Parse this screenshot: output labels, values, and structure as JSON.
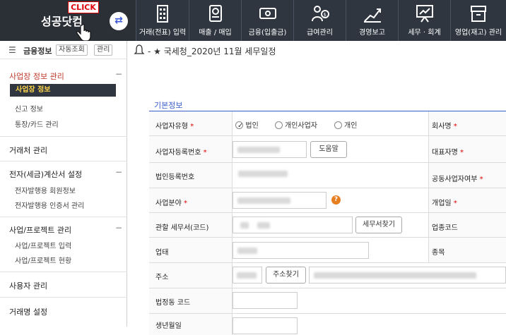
{
  "brand": {
    "name": "성공닷컴",
    "click_badge": "CLICK"
  },
  "top_menu": [
    {
      "label": "거래(전표) 입력",
      "icon": "building-icon"
    },
    {
      "label": "매출 / 매입",
      "icon": "report-icon"
    },
    {
      "label": "금융(입출금)",
      "icon": "money-icon"
    },
    {
      "label": "급여관리",
      "icon": "person-coin-icon"
    },
    {
      "label": "경영보고",
      "icon": "growth-chart-icon"
    },
    {
      "label": "세무 · 회계",
      "icon": "presentation-icon"
    },
    {
      "label": "영업(재고) 관리",
      "icon": "box-icon"
    }
  ],
  "sidebar": {
    "title": "금융정보",
    "auto_btn": "자동조회",
    "manage_btn": "관리",
    "sections": [
      {
        "title": "사업장 정보 관리",
        "items": [
          "사업장 정보",
          "신고 정보",
          "통장/카드 관리"
        ]
      },
      {
        "title": "거래처 관리",
        "items": []
      },
      {
        "title": "전자(세금)계산서 설정",
        "items": [
          "전자발행용 회원정보",
          "전자발행용 인증서 관리"
        ]
      },
      {
        "title": "사업/프로젝트 관리",
        "items": [
          "사업/프로젝트 입력",
          "사업/프로젝트 현황"
        ]
      },
      {
        "title": "사용자 관리",
        "items": []
      },
      {
        "title": "거래명 설정",
        "items": []
      }
    ]
  },
  "breadcrumb": "- ★ 국세청_2020년 11월 세무일정",
  "form": {
    "section_title": "기본정보",
    "business_type_label": "사업자유형",
    "business_type_options": [
      "법인",
      "개인사업자",
      "개인"
    ],
    "business_type_selected": "법인",
    "reg_no_label": "사업자등록번호",
    "help_btn": "도움말",
    "corp_no_label": "법인등록번호",
    "field_label": "사업분야",
    "tax_office_label": "관할 세무서(코드)",
    "tax_office_btn": "세무서찾기",
    "category_label": "업태",
    "address_label": "주소",
    "address_btn": "주소찾기",
    "legal_code_label": "법정동 코드",
    "birth_label": "생년월일",
    "company_label": "회사명",
    "rep_label": "대표자명",
    "joint_label": "공동사업자여부",
    "open_date_label": "개업일",
    "industry_code_label": "업종코드",
    "item_label": "종목",
    "required_mark": "*"
  }
}
